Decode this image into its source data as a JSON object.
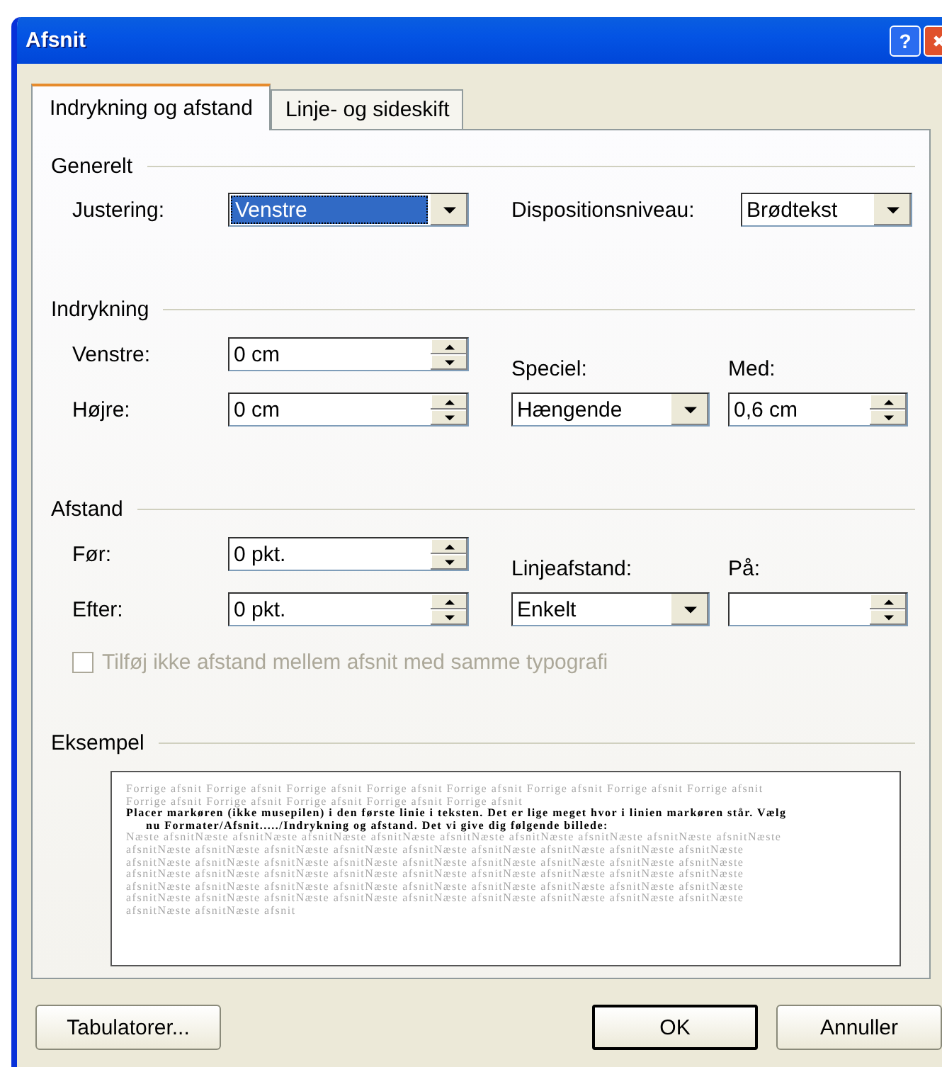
{
  "window": {
    "title": "Afsnit",
    "help_button": "?"
  },
  "tabs": [
    {
      "label": "Indrykning og afstand",
      "selected": true
    },
    {
      "label": "Linje- og sideskift",
      "selected": false
    }
  ],
  "general": {
    "title": "Generelt",
    "fields": [
      {
        "label": "Justering:",
        "kind": "combo",
        "value": "Venstre",
        "focused": true
      },
      {
        "label": "Dispositionsniveau:",
        "kind": "combo",
        "value": "Brødtekst",
        "focused": false
      }
    ]
  },
  "sections": [
    {
      "title": "Indrykning",
      "left": [
        {
          "label": "Venstre:",
          "kind": "spin",
          "value": "0 cm"
        },
        {
          "label": "Højre:",
          "kind": "spin",
          "value": "0 cm"
        }
      ],
      "right": [
        {
          "label": "Speciel:",
          "kind": "combo",
          "value": "Hængende"
        },
        {
          "label": "Med:",
          "kind": "spin",
          "value": "0,6 cm"
        }
      ]
    },
    {
      "title": "Afstand",
      "left": [
        {
          "label": "Før:",
          "kind": "spin",
          "value": "0 pkt."
        },
        {
          "label": "Efter:",
          "kind": "spin",
          "value": "0 pkt."
        }
      ],
      "right": [
        {
          "label": "Linjeafstand:",
          "kind": "combo",
          "value": "Enkelt"
        },
        {
          "label": "På:",
          "kind": "spin"
        }
      ],
      "checkbox": {
        "label": "Tilføj ikke afstand mellem afsnit med samme typografi",
        "checked": false,
        "disabled": true
      }
    }
  ],
  "preview": {
    "title": "Eksempel",
    "previous": "Forrige afsnit Forrige afsnit Forrige afsnit Forrige afsnit Forrige afsnit Forrige afsnit Forrige afsnit Forrige afsnit Forrige afsnit Forrige afsnit Forrige afsnit Forrige afsnit Forrige afsnit",
    "sample": "Placer markøren (ikke musepilen) i den første linie i teksten. Det er lige meget hvor i linien markøren står. Vælg nu Formater/Afsnit...../Indrykning og afstand. Det vi give dig følgende billede:",
    "next": "Næste afsnitNæste afsnitNæste afsnitNæste afsnitNæste afsnitNæste afsnitNæste afsnitNæste afsnitNæste afsnitNæste afsnitNæste afsnitNæste afsnitNæste afsnitNæste afsnitNæste afsnitNæste afsnitNæste afsnitNæste afsnitNæste afsnitNæste afsnitNæste afsnitNæste afsnitNæste afsnitNæste afsnitNæste afsnitNæste afsnitNæste afsnitNæste afsnitNæste afsnitNæste afsnitNæste afsnitNæste afsnitNæste afsnitNæste afsnitNæste afsnitNæste afsnitNæste afsnitNæste afsnitNæste afsnitNæste afsnitNæste afsnitNæste afsnitNæste afsnitNæste afsnitNæste afsnitNæste afsnitNæste afsnitNæste afsnitNæste afsnitNæste afsnitNæste afsnitNæste afsnitNæste afsnitNæste afsnitNæste afsnitNæste afsnitNæste afsnit"
  },
  "buttons": [
    {
      "label": "Tabulatorer...",
      "default": false
    },
    {
      "label": "OK",
      "default": true
    },
    {
      "label": "Annuller",
      "default": false
    }
  ]
}
